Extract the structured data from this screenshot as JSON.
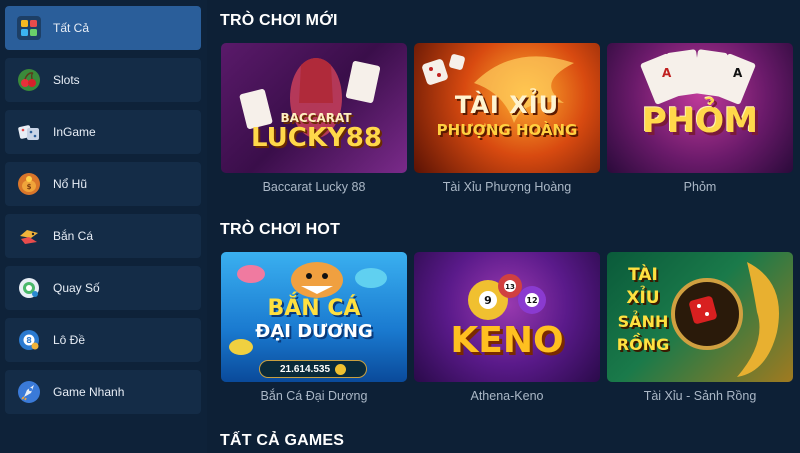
{
  "sidebar": {
    "items": [
      {
        "label": "Tất Cả",
        "icon": "grid-icon"
      },
      {
        "label": "Slots",
        "icon": "cherry-icon"
      },
      {
        "label": "InGame",
        "icon": "dice-icon"
      },
      {
        "label": "Nổ Hũ",
        "icon": "jackpot-pot-icon"
      },
      {
        "label": "Bắn Cá",
        "icon": "fish-icon"
      },
      {
        "label": "Quay Số",
        "icon": "lottery-ball-icon"
      },
      {
        "label": "Lô Đề",
        "icon": "number-ball-icon"
      },
      {
        "label": "Game Nhanh",
        "icon": "rocket-icon"
      }
    ]
  },
  "sections": {
    "new": {
      "title": "TRÒ CHƠI MỚI",
      "games": [
        {
          "label": "Baccarat Lucky 88",
          "art_line1": "BACCARAT",
          "art_line2": "LUCKY88"
        },
        {
          "label": "Tài Xỉu Phượng Hoàng",
          "art_line1": "TÀI XỈU",
          "art_line2": "PHƯỢNG HOÀNG"
        },
        {
          "label": "Phỏm",
          "art_line1": "PHỎM"
        }
      ]
    },
    "hot": {
      "title": "TRÒ CHƠI HOT",
      "games": [
        {
          "label": "Bắn Cá Đại Dương",
          "art_line1": "BẮN CÁ",
          "art_line2": "ĐẠI DƯƠNG",
          "art_amount": "21.614.535"
        },
        {
          "label": "Athena-Keno",
          "art_line1": "KENO",
          "ball_numbers": [
            "13",
            "9",
            "12"
          ]
        },
        {
          "label": "Tài Xỉu - Sảnh Rồng",
          "art_line1": "TÀI",
          "art_line2": "XỈU",
          "art_line3": "SẢNH",
          "art_line4": "RỒNG"
        }
      ]
    },
    "all": {
      "title": "TẤT CẢ GAMES"
    }
  },
  "colors": {
    "background": "#0d2036",
    "sidebar_item": "#142c47",
    "sidebar_active": "#2a5e9a",
    "label_text": "#aab7c6"
  }
}
